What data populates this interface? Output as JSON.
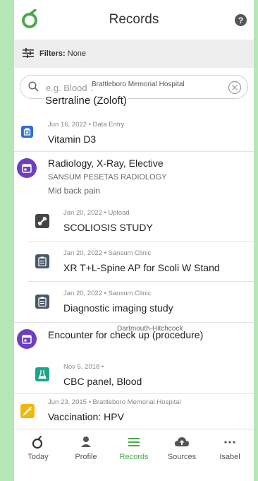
{
  "header": {
    "title": "Records",
    "logo_icon": "app-logo-icon",
    "help_icon": "help-icon"
  },
  "filters": {
    "label": "Filters:",
    "value": "None"
  },
  "search": {
    "placeholder": "e.g. Blood T",
    "tooltip": "Brattleboro Memorial Hospital",
    "overlay_name": "Sertraline (Zoloft)"
  },
  "records": [
    {
      "meta": "Jun 16, 2022  •  Data Entry",
      "name": "Vitamin D3",
      "icon": "medication-icon",
      "color": "#2a6fd6"
    },
    {
      "name": "Radiology, X-Ray, Elective",
      "sub1": "SANSUM PESETAS RADIOLOGY",
      "sub2": "Mid back pain",
      "icon": "calendar-icon",
      "color": "#6c3fc2"
    },
    {
      "meta": "Jan 20, 2022  •  Upload",
      "name": "SCOLIOSIS STUDY",
      "icon": "bone-icon",
      "color": "#444444"
    },
    {
      "meta": "Jan 20, 2022  •  Sansum Clinic",
      "name": "XR T+L-Spine AP for Scoli W Stand",
      "icon": "clipboard-icon",
      "color": "#4a5866"
    },
    {
      "meta": "Jan 20, 2022  •  Sansum Clinic",
      "name": "Diagnostic imaging study",
      "icon": "clipboard-icon",
      "color": "#4a5866"
    },
    {
      "meta": "Dartmouth-Hitchcock",
      "name": "Encounter for check up (procedure)",
      "icon": "calendar-icon",
      "color": "#6c3fc2"
    },
    {
      "meta": "Nov 5, 2018  •",
      "name": "CBC panel, Blood",
      "icon": "flask-icon",
      "color": "#1aa58a"
    },
    {
      "meta": "Jun 23, 2015  •  Brattleboro Memorial Hospital",
      "name": "Vaccination: HPV",
      "icon": "syringe-icon",
      "color": "#f2b70f"
    }
  ],
  "nav": [
    {
      "label": "Today",
      "icon": "today-icon"
    },
    {
      "label": "Profile",
      "icon": "person-icon"
    },
    {
      "label": "Records",
      "icon": "records-icon",
      "active": true
    },
    {
      "label": "Sources",
      "icon": "cloud-upload-icon"
    },
    {
      "label": "Isabel",
      "icon": "more-icon"
    }
  ],
  "colors": {
    "accent": "#4aa84a",
    "background": "#b5e6b5"
  }
}
